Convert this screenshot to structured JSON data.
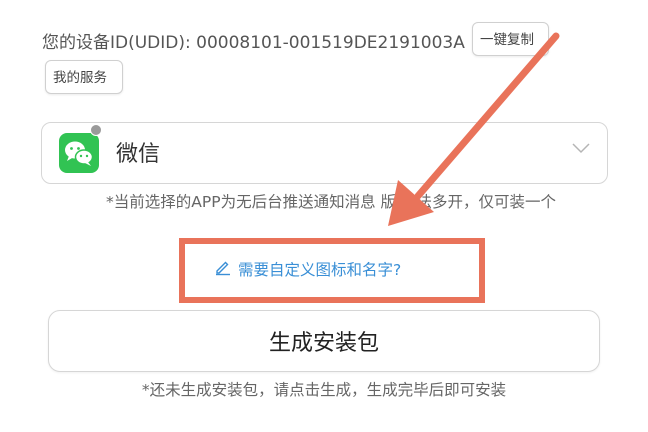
{
  "device": {
    "udid_text": "您的设备ID(UDID): 00008101-001519DE2191003A",
    "copy_button": "一键复制",
    "service_button": "我的服务"
  },
  "app_select": {
    "icon": "wechat-icon",
    "selected_app": "微信"
  },
  "notice": "*当前选择的APP为无后台推送通知消息 版 无法多开，仅可装一个",
  "customize_link": "需要自定义图标和名字?",
  "generate_button": "生成安装包",
  "hint": "*还未生成安装包，请点击生成，生成完毕后即可安装",
  "colors": {
    "link": "#3a8fd6",
    "annotation": "#e9735a",
    "wechat_green": "#31c353"
  }
}
